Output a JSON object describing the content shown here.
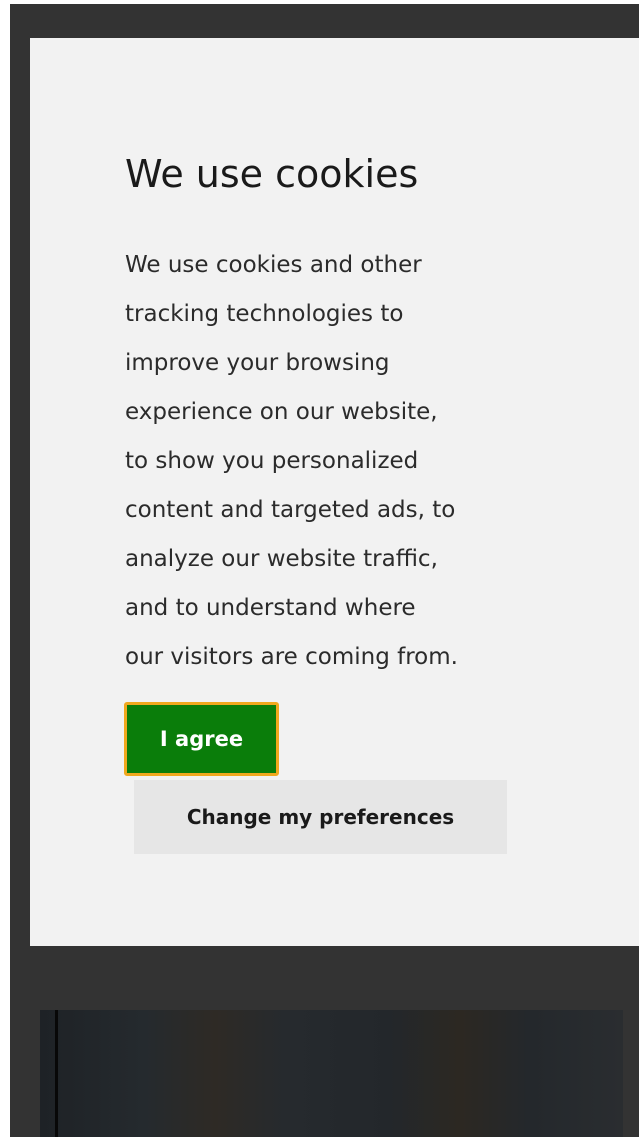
{
  "cookie_banner": {
    "title": "We use cookies",
    "body": "We use cookies and other\ntracking technologies to\nimprove your browsing\nexperience on our website,\nto show you personalized\ncontent and targeted ads, to\nanalyze our website traffic,\nand to understand where\nour visitors are coming from.",
    "agree_label": "I agree",
    "preferences_label": "Change my preferences"
  },
  "colors": {
    "agree_background": "#0a7d0a",
    "agree_focus_outline": "#f0a81e",
    "modal_background": "#f2f2f2",
    "backdrop": "#333333"
  }
}
